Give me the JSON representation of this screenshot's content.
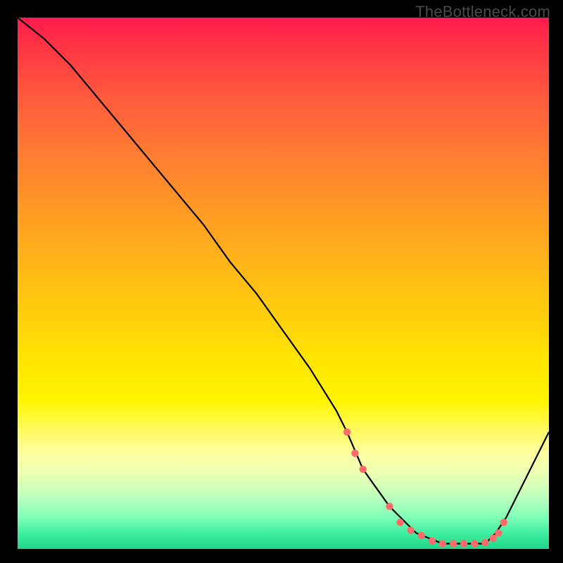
{
  "watermark": "TheBottleneck.com",
  "chart_data": {
    "type": "line",
    "title": "",
    "xlabel": "",
    "ylabel": "",
    "xlim": [
      0,
      100
    ],
    "ylim": [
      0,
      100
    ],
    "background_gradient": {
      "stops": [
        {
          "pos": 0,
          "color": "#ff1a4d"
        },
        {
          "pos": 0.5,
          "color": "#ffd400"
        },
        {
          "pos": 0.82,
          "color": "#fdffa0"
        },
        {
          "pos": 1.0,
          "color": "#1fd88a"
        }
      ]
    },
    "series": [
      {
        "name": "bottleneck-curve",
        "x": [
          0,
          5,
          10,
          15,
          20,
          25,
          30,
          35,
          40,
          45,
          50,
          55,
          60,
          62,
          65,
          70,
          75,
          80,
          85,
          88,
          90,
          92,
          95,
          100
        ],
        "y": [
          100,
          96,
          91,
          85,
          79,
          73,
          67,
          61,
          54,
          48,
          41,
          34,
          26,
          22,
          15,
          8,
          3,
          1,
          1,
          1,
          3,
          6,
          12,
          22
        ]
      }
    ],
    "markers": {
      "name": "highlight-dots",
      "color": "#ff6a6a",
      "x": [
        62,
        63.5,
        65,
        70,
        72,
        74,
        76,
        78,
        80,
        82,
        84,
        86,
        88,
        89.5,
        90.5,
        91.5
      ],
      "y": [
        22,
        18,
        15,
        8,
        5,
        3.5,
        2.5,
        1.5,
        1,
        1,
        1,
        1,
        1.2,
        2,
        3,
        5
      ]
    }
  }
}
